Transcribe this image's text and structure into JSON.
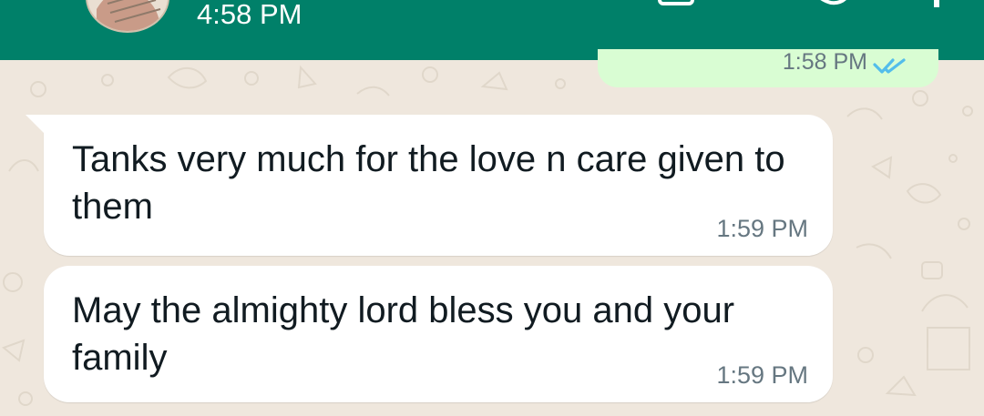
{
  "header": {
    "subtitle": "4:58 PM",
    "background_color": "#008069",
    "icons": [
      "avatar",
      "call-icon",
      "more-options-icon"
    ]
  },
  "messages": [
    {
      "direction": "outgoing",
      "time": "1:58 PM",
      "status_icon": "double-check-read-icon",
      "bubble_color": "#d9fdd3"
    },
    {
      "direction": "incoming",
      "text": "Tanks very much for the love n care given to them",
      "time": "1:59 PM",
      "bubble_color": "#ffffff"
    },
    {
      "direction": "incoming",
      "text": "May the almighty lord bless you and your family",
      "time": "1:59 PM",
      "bubble_color": "#ffffff"
    }
  ],
  "colors": {
    "chat_background": "#efe7dd",
    "read_tick": "#53bdeb",
    "message_text": "#111b21",
    "timestamp": "#667781"
  }
}
